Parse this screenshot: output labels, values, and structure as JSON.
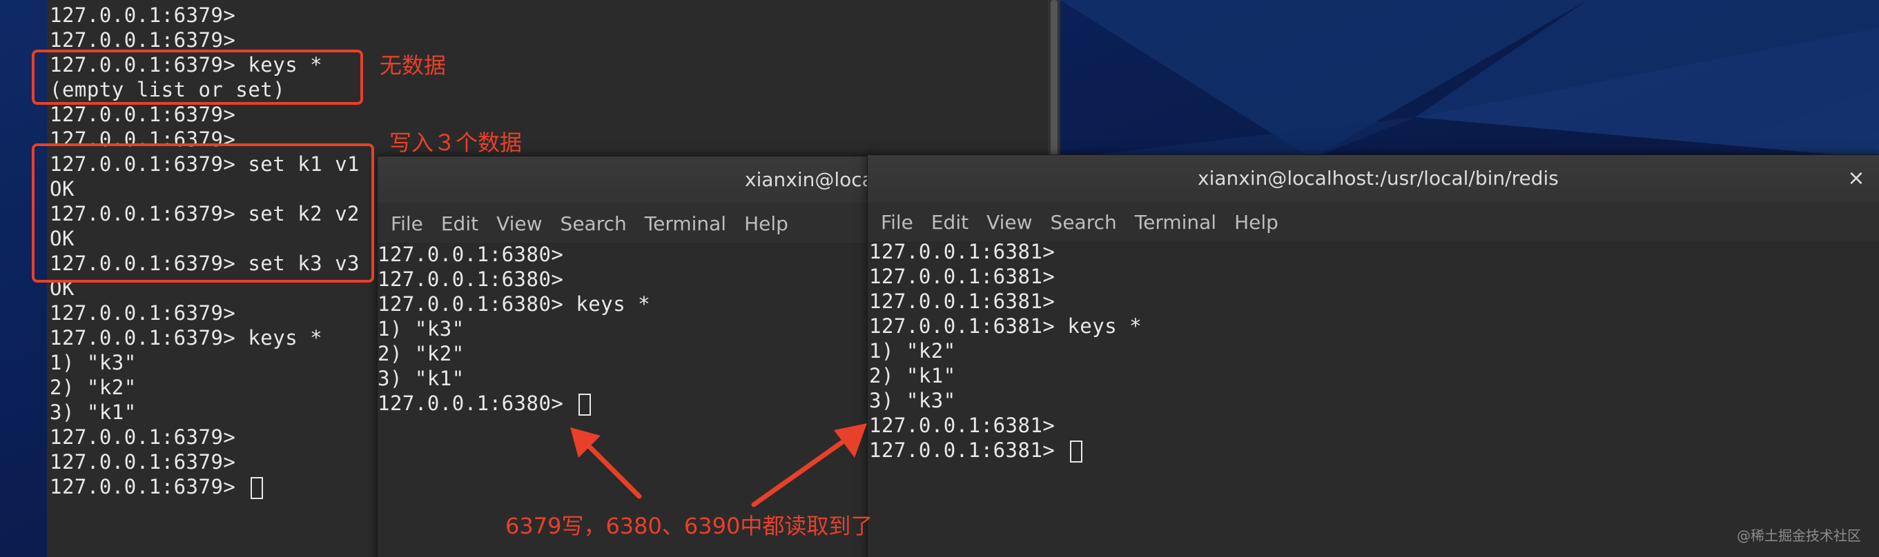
{
  "terminal_6379": {
    "lines": [
      "127.0.0.1:6379>",
      "127.0.0.1:6379>",
      "127.0.0.1:6379> keys *",
      "(empty list or set)",
      "127.0.0.1:6379>",
      "127.0.0.1:6379>",
      "127.0.0.1:6379> set k1 v1",
      "OK",
      "127.0.0.1:6379> set k2 v2",
      "OK",
      "127.0.0.1:6379> set k3 v3",
      "OK",
      "127.0.0.1:6379>",
      "127.0.0.1:6379> keys *",
      "1) \"k3\"",
      "2) \"k2\"",
      "3) \"k1\"",
      "127.0.0.1:6379>",
      "127.0.0.1:6379>",
      "127.0.0.1:6379> "
    ]
  },
  "window_6380": {
    "title": "xianxin@localhost:/usr/local/bin/redis",
    "menu": [
      "File",
      "Edit",
      "View",
      "Search",
      "Terminal",
      "Help"
    ],
    "lines": [
      "127.0.0.1:6380>",
      "127.0.0.1:6380>",
      "127.0.0.1:6380> keys *",
      "1) \"k3\"",
      "2) \"k2\"",
      "3) \"k1\"",
      "127.0.0.1:6380> "
    ]
  },
  "window_6381": {
    "title": "xianxin@localhost:/usr/local/bin/redis",
    "close_glyph": "×",
    "menu": [
      "File",
      "Edit",
      "View",
      "Search",
      "Terminal",
      "Help"
    ],
    "lines": [
      "127.0.0.1:6381>",
      "127.0.0.1:6381>",
      "127.0.0.1:6381>",
      "127.0.0.1:6381> keys *",
      "1) \"k2\"",
      "2) \"k1\"",
      "3) \"k3\"",
      "127.0.0.1:6381>",
      "127.0.0.1:6381> "
    ]
  },
  "annotations": {
    "no_data": "无数据",
    "write_three": "写入３个数据",
    "read_note": "6379写，6380、6390中都读取到了",
    "color": "#e8402a"
  },
  "watermark": "@稀土掘金技术社区"
}
